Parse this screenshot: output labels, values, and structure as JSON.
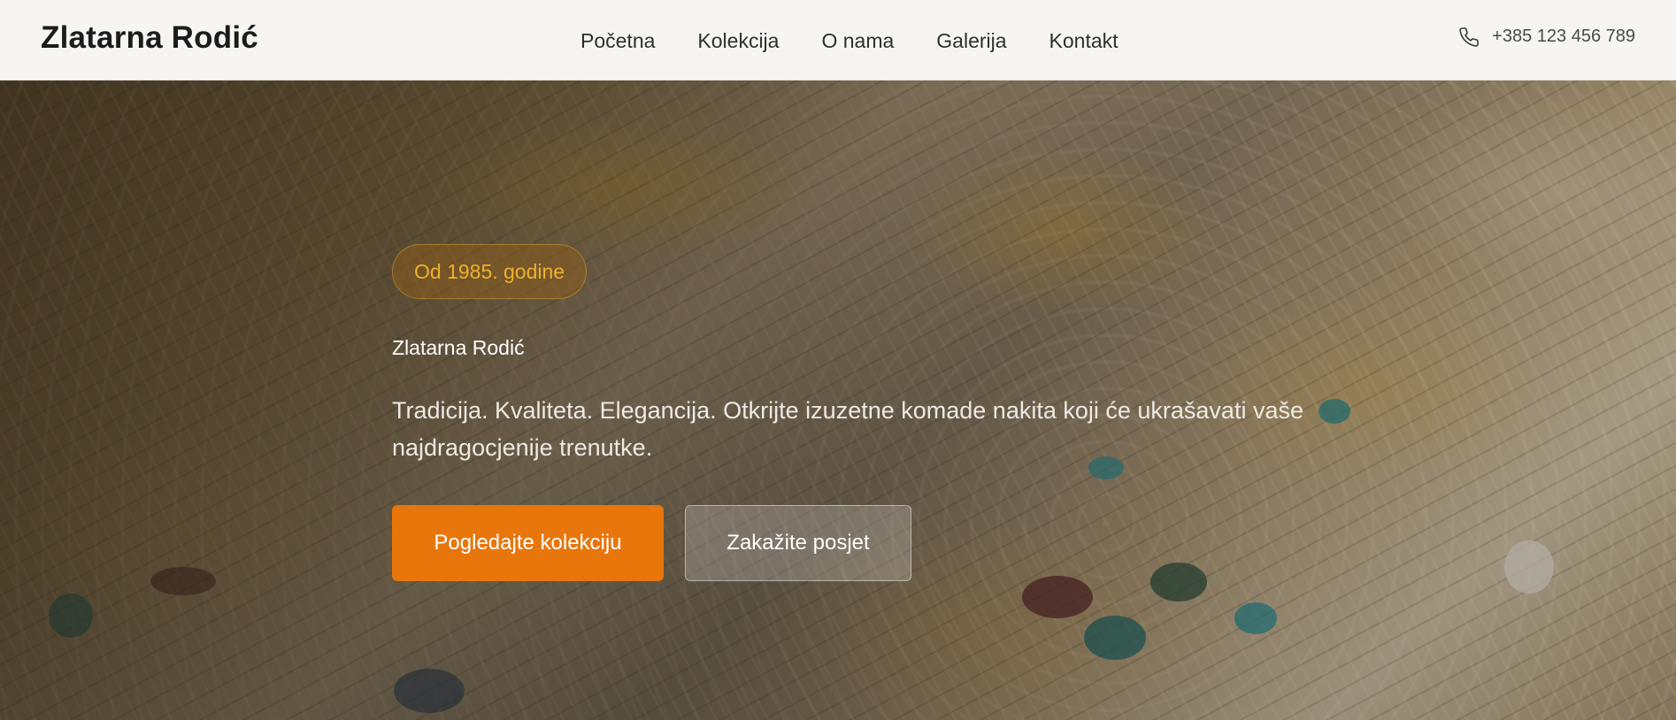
{
  "header": {
    "logo": "Zlatarna Rodić",
    "nav": [
      "Početna",
      "Kolekcija",
      "O nama",
      "Galerija",
      "Kontakt"
    ],
    "phone_icon": "phone-icon",
    "phone": "+385 123 456 789"
  },
  "hero": {
    "badge": "Od 1985. godine",
    "title": "Zlatarna Rodić",
    "text": "Tradicija. Kvaliteta. Elegancija. Otkrijte izuzetne komade nakita koji će ukrašavati vaše najdragocjenije trenutke.",
    "primary_button": "Pogledajte kolekciju",
    "secondary_button": "Zakažite posjet",
    "background_image": "jewelry-display-photo"
  },
  "colors": {
    "accent": "#e8760b",
    "badge_text": "#f0b12a"
  }
}
